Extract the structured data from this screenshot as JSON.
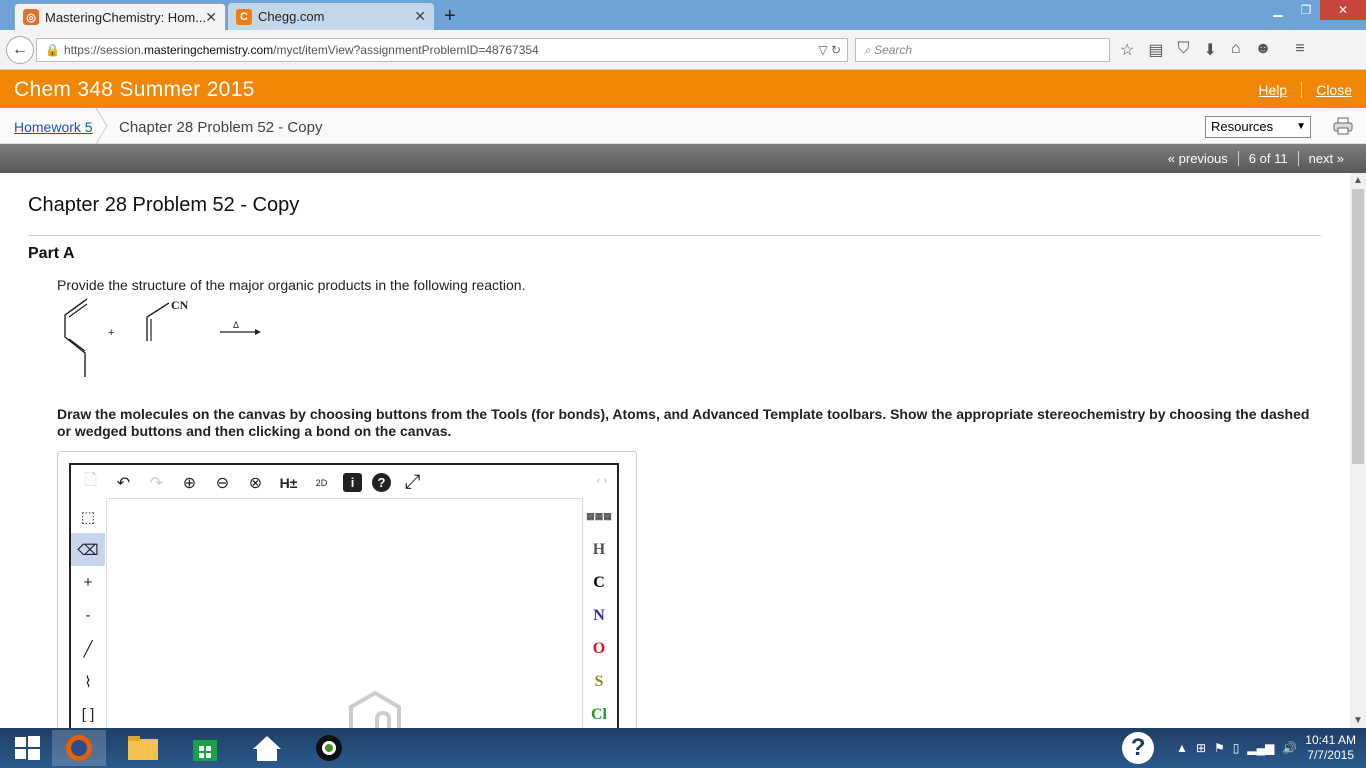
{
  "browser": {
    "tabs": [
      {
        "title": "MasteringChemistry: Hom...",
        "active": true
      },
      {
        "title": "Chegg.com",
        "active": false
      }
    ],
    "url": {
      "prefix": "https://session.",
      "domain": "masteringchemistry.com",
      "path": "/myct/itemView?assignmentProblemID=48767354"
    },
    "search_placeholder": "Search"
  },
  "header": {
    "course": "Chem 348 Summer 2015",
    "help": "Help",
    "close": "Close"
  },
  "breadcrumb": {
    "parent": "Homework 5",
    "current": "Chapter 28 Problem 52 - Copy"
  },
  "resources_select": "Resources",
  "pager": {
    "previous": "« previous",
    "position": "6 of 11",
    "next": "next »"
  },
  "problem": {
    "title": "Chapter 28 Problem 52 - Copy",
    "part": "Part A",
    "prompt": "Provide the structure of the major organic products in the following reaction.",
    "reaction_labels": {
      "nitrile": "CN",
      "plus": "+",
      "heat": "Δ"
    },
    "instructions": "Draw the molecules on the canvas by choosing buttons from the Tools (for bonds), Atoms, and Advanced Template toolbars. Show the appropriate stereochemistry by choosing the dashed or wedged buttons and then clicking a bond on the canvas."
  },
  "editor": {
    "top_tools": [
      "new-document",
      "undo",
      "redo",
      "zoom-in",
      "zoom-out",
      "zoom-reset",
      "H±",
      "2D",
      "info",
      "help",
      "fullscreen"
    ],
    "hplus_label": "H±",
    "twod_label": "2D",
    "left_tools": {
      "plus": "+",
      "minus": "-"
    },
    "atoms": [
      {
        "symbol": "H",
        "color": "#555555"
      },
      {
        "symbol": "C",
        "color": "#000000"
      },
      {
        "symbol": "N",
        "color": "#2f2fa0"
      },
      {
        "symbol": "O",
        "color": "#e01010"
      },
      {
        "symbol": "S",
        "color": "#8a8a1a"
      },
      {
        "symbol": "Cl",
        "color": "#1a9a1a"
      }
    ]
  },
  "taskbar": {
    "time": "10:41 AM",
    "date": "7/7/2015"
  }
}
